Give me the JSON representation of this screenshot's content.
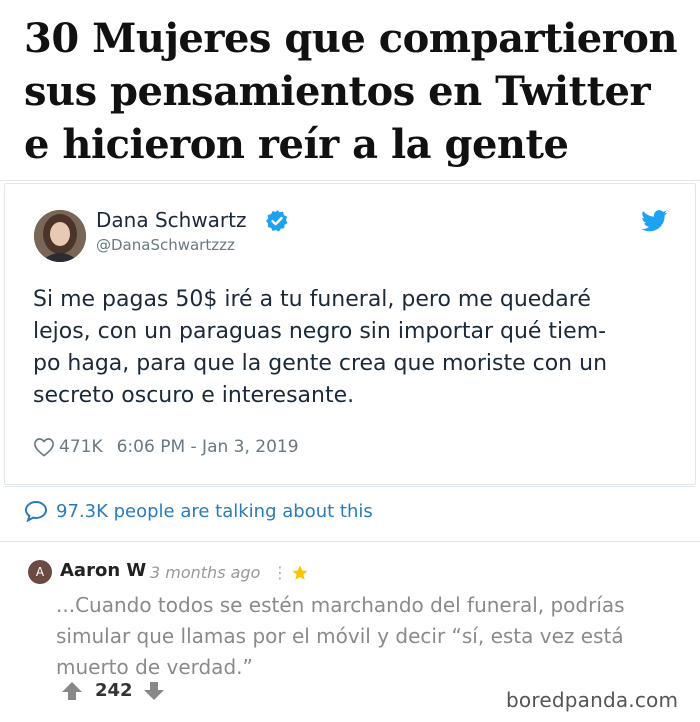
{
  "headline": {
    "lines": [
      "30 Mujeres que compartieron",
      "sus pensamientos en Twitter",
      "e hicieron reír a la gente"
    ]
  },
  "tweet": {
    "author_name": "Dana Schwartz",
    "author_handle": "@DanaSchwartzzz",
    "body_lines": [
      "Si me pagas 50$ iré a tu funeral, pero me quedaré",
      "lejos, con un paraguas negro sin importar qué tiem-",
      "po haga, para que la gente crea que moriste con un",
      "secreto oscuro e interesante."
    ],
    "likes": "471K",
    "timestamp": "6:06 PM - Jan 3, 2019",
    "talking": "97.3K people are talking about this",
    "colors": {
      "twitter_blue": "#1da1f2",
      "verified": "#1da1f2",
      "link": "#2b7bb9"
    },
    "icons": [
      "verified-badge-icon",
      "twitter-bird-icon",
      "heart-icon",
      "speech-bubble-icon"
    ]
  },
  "comment": {
    "avatar_initial": "A",
    "author": "Aaron W",
    "time": "3 months ago",
    "menu": "⋮",
    "body_lines": [
      "...Cuando todos se estén marchando del funeral, podrías",
      "simular que llamas por el móvil y decir “sí, esta vez está",
      "muerto de verdad.”"
    ],
    "votes": "242",
    "icons": [
      "star-icon",
      "upvote-arrow-icon",
      "downvote-arrow-icon"
    ]
  },
  "watermark": "boredpanda.com"
}
